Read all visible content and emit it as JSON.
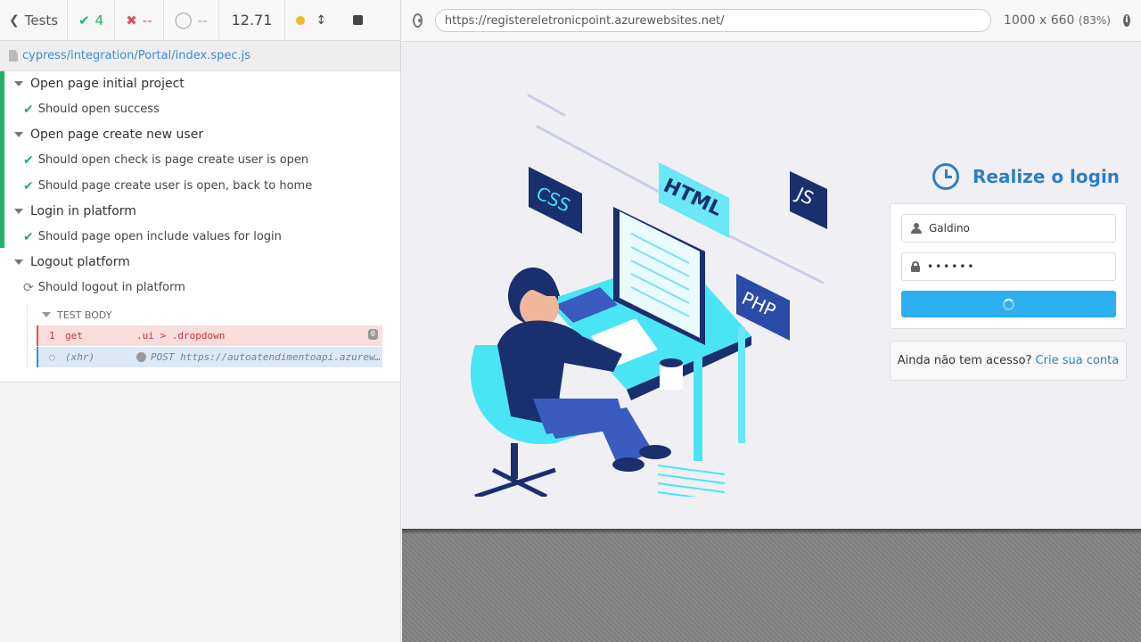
{
  "reporter": {
    "stats": {
      "tests_label": "Tests",
      "passed": "4",
      "failed": "--",
      "pending": "--",
      "duration": "12.71"
    },
    "spec_path": "cypress/integration/Portal/index.spec.js",
    "suites": [
      {
        "title": "Open page initial project",
        "tests": [
          "Should open success"
        ]
      },
      {
        "title": "Open page create new user",
        "tests": [
          "Should open check is page create user is open",
          "Should page create user is open, back to home"
        ]
      },
      {
        "title": "Login in platform",
        "tests": [
          "Should page open include values for login"
        ]
      },
      {
        "title": "Logout platform",
        "tests": [
          "Should logout in platform"
        ]
      }
    ],
    "test_body_label": "TEST BODY",
    "commands": [
      {
        "num": "1",
        "name": "get",
        "message": ".ui > .dropdown",
        "badge": "0"
      },
      {
        "num": "",
        "name": "(xhr)",
        "message": "POST https://autoatendimentoapi.azurewebsites.net/"
      }
    ],
    "colors": {
      "pass": "#1fb36b",
      "fail": "#e25050",
      "link": "#3a8ed8"
    }
  },
  "aut": {
    "url": "https://registereletronicpoint.azurewebsites.net/",
    "viewport": "1000 x 660",
    "scale": "(83%)",
    "login": {
      "title": "Realize o login",
      "username": "Galdino",
      "password": "••••••",
      "signup_text": "Ainda não tem acesso?",
      "signup_link": "Crie sua conta"
    },
    "illustration_labels": [
      "CSS",
      "HTML",
      "JS",
      "PHP"
    ],
    "colors": {
      "accent": "#2d7fc4",
      "button": "#2eaff0"
    }
  }
}
